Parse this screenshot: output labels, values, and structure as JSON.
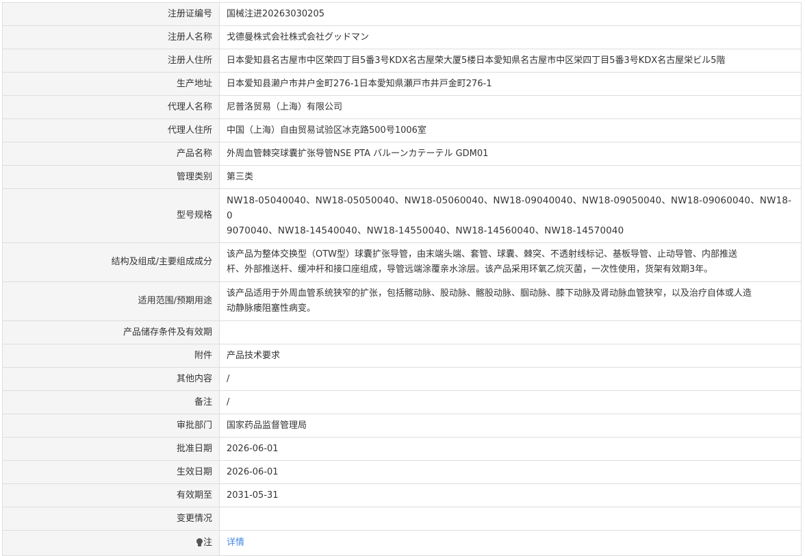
{
  "rows": [
    {
      "label": "注册证编号",
      "value": "国械注进20263030205"
    },
    {
      "label": "注册人名称",
      "value": "戈德曼株式会社株式会社グッドマン"
    },
    {
      "label": "注册人住所",
      "value": "日本愛知县名古屋市中区荣四丁目5番3号KDX名古屋荣大厦5楼日本愛知県名古屋市中区栄四丁目5番3号KDX名古屋栄ビル5階"
    },
    {
      "label": "生产地址",
      "value": "日本爱知县濑户市井户金町276-1日本愛知県瀬戸市井戸金町276-1"
    },
    {
      "label": "代理人名称",
      "value": "尼普洛贸易（上海）有限公司"
    },
    {
      "label": "代理人住所",
      "value": "中国（上海）自由贸易试验区冰克路500号1006室"
    },
    {
      "label": "产品名称",
      "value": "外周血管棘突球囊扩张导管NSE PTA バルーンカテーテル GDM01"
    },
    {
      "label": "管理类别",
      "value": "第三类"
    },
    {
      "label": "型号规格",
      "lines": [
        "NW18-05040040、NW18-05050040、NW18-05060040、NW18-09040040、NW18-09050040、NW18-09060040、NW18-0",
        "9070040、NW18-14540040、NW18-14550040、NW18-14560040、NW18-14570040"
      ]
    },
    {
      "label": "结构及组成/主要组成成分",
      "lines": [
        "该产品为整体交换型（OTW型）球囊扩张导管，由末端头端、套管、球囊、棘突、不透射线标记、基板导管、止动导管、内部推送",
        "杆、外部推送杆、缓冲杆和接口座组成，导管远端涂覆亲水涂层。该产品采用环氧乙烷灭菌，一次性使用，货架有效期3年。"
      ]
    },
    {
      "label": "适用范围/预期用途",
      "lines": [
        "该产品适用于外周血管系统狭窄的扩张，包括髂动脉、股动脉、髂股动脉、腘动脉、膝下动脉及肾动脉血管狭窄，以及治疗自体或人造",
        "动静脉瘘阻塞性病变。"
      ]
    },
    {
      "label": "产品储存条件及有效期",
      "value": ""
    },
    {
      "label": "附件",
      "value": "产品技术要求"
    },
    {
      "label": "其他内容",
      "value": "/"
    },
    {
      "label": "备注",
      "value": "/"
    },
    {
      "label": "审批部门",
      "value": "国家药品监督管理局"
    },
    {
      "label": "批准日期",
      "value": "2026-06-01"
    },
    {
      "label": "生效日期",
      "value": "2026-06-01"
    },
    {
      "label": "有效期至",
      "value": "2031-05-31"
    },
    {
      "label": "变更情况",
      "value": ""
    }
  ],
  "note": {
    "label": "注",
    "icon": "lightbulb-icon",
    "link_text": "详情"
  },
  "colors": {
    "label_bg": "#f5f5f5",
    "border": "#dddddd",
    "text": "#333333",
    "link": "#4188e6"
  }
}
